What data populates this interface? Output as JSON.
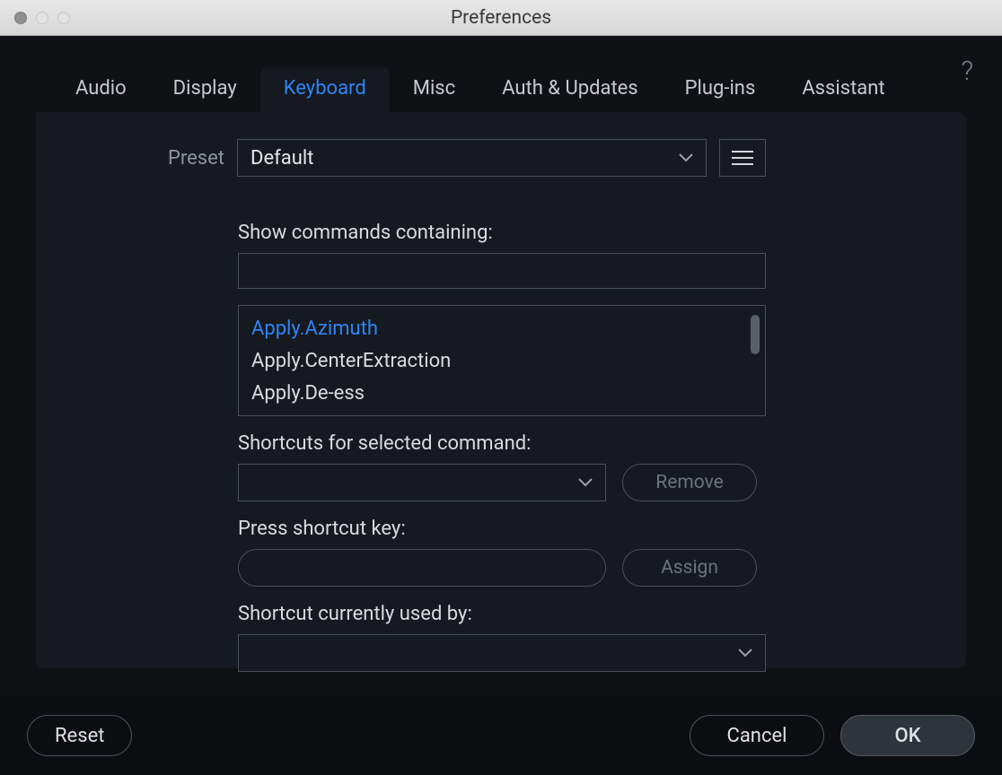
{
  "window": {
    "title": "Preferences"
  },
  "tabs": [
    {
      "label": "Audio"
    },
    {
      "label": "Display"
    },
    {
      "label": "Keyboard"
    },
    {
      "label": "Misc"
    },
    {
      "label": "Auth & Updates"
    },
    {
      "label": "Plug-ins"
    },
    {
      "label": "Assistant"
    }
  ],
  "preset": {
    "label": "Preset",
    "value": "Default"
  },
  "filter": {
    "label": "Show commands containing:",
    "value": ""
  },
  "commands": [
    "Apply.Azimuth",
    "Apply.CenterExtraction",
    "Apply.De-ess"
  ],
  "shortcuts": {
    "selected_label": "Shortcuts for selected command:",
    "selected_value": "",
    "remove_label": "Remove",
    "press_label": "Press shortcut key:",
    "press_value": "",
    "assign_label": "Assign",
    "used_by_label": "Shortcut currently used by:",
    "used_by_value": ""
  },
  "footer": {
    "reset": "Reset",
    "cancel": "Cancel",
    "ok": "OK"
  }
}
